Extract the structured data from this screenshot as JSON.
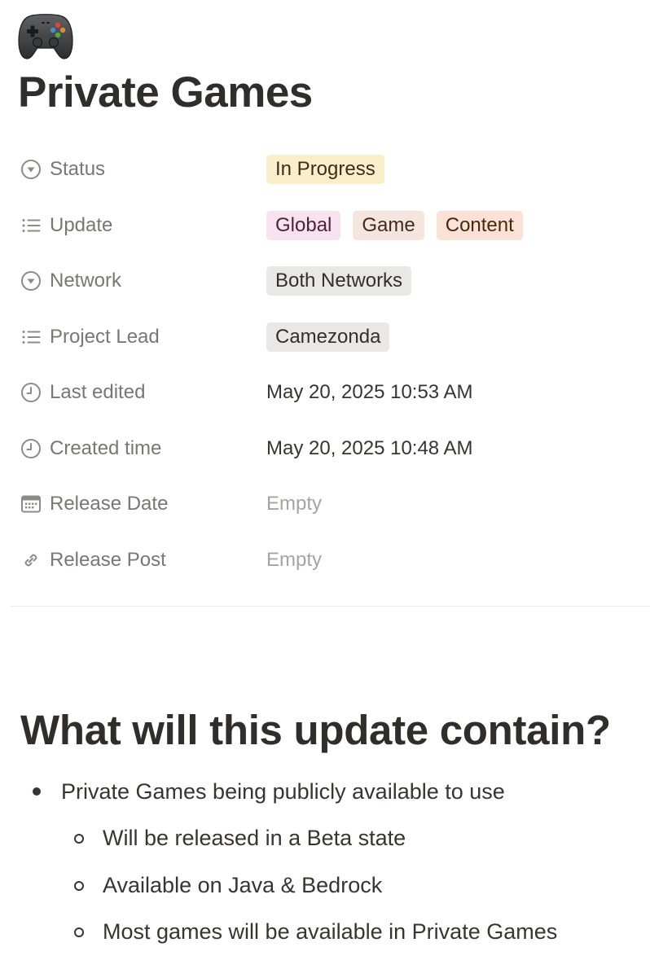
{
  "page": {
    "icon": "video-game-controller-icon",
    "title": "Private Games"
  },
  "properties": [
    {
      "icon": "status-circle-icon",
      "name": "Status",
      "type": "tags",
      "tags": [
        {
          "label": "In Progress",
          "bg": "#fbeecb",
          "fg": "#402c1b"
        }
      ]
    },
    {
      "icon": "multi-select-list-icon",
      "name": "Update",
      "type": "tags",
      "tags": [
        {
          "label": "Global",
          "bg": "#f9e2ef",
          "fg": "#4c2337"
        },
        {
          "label": "Game",
          "bg": "#f4e5de",
          "fg": "#44291c"
        },
        {
          "label": "Content",
          "bg": "#fbe1d6",
          "fg": "#49290e"
        }
      ]
    },
    {
      "icon": "status-circle-icon",
      "name": "Network",
      "type": "tags",
      "tags": [
        {
          "label": "Both Networks",
          "bg": "#e9e8e5",
          "fg": "#32302c"
        }
      ]
    },
    {
      "icon": "multi-select-list-icon",
      "name": "Project Lead",
      "type": "tags",
      "tags": [
        {
          "label": "Camezonda",
          "bg": "#e9e8e5",
          "fg": "#32302c"
        }
      ]
    },
    {
      "icon": "clock-icon",
      "name": "Last edited",
      "type": "text",
      "value": "May 20, 2025 10:53 AM"
    },
    {
      "icon": "clock-icon",
      "name": "Created time",
      "type": "text",
      "value": "May 20, 2025 10:48 AM"
    },
    {
      "icon": "calendar-icon",
      "name": "Release Date",
      "type": "empty",
      "value": "Empty"
    },
    {
      "icon": "link-icon",
      "name": "Release Post",
      "type": "empty",
      "value": "Empty"
    }
  ],
  "content": {
    "heading": "What will this update contain?",
    "bullets": [
      {
        "text": "Private Games being publicly available to use",
        "children": [
          "Will be released in a Beta state",
          "Available on Java & Bedrock",
          "Most games will be available in Private Games"
        ]
      }
    ]
  },
  "colors": {
    "title": "#2f2e2a",
    "property_label": "#787774",
    "empty_value": "#a6a49f",
    "divider": "#ebebea",
    "body_text": "#37352f"
  }
}
